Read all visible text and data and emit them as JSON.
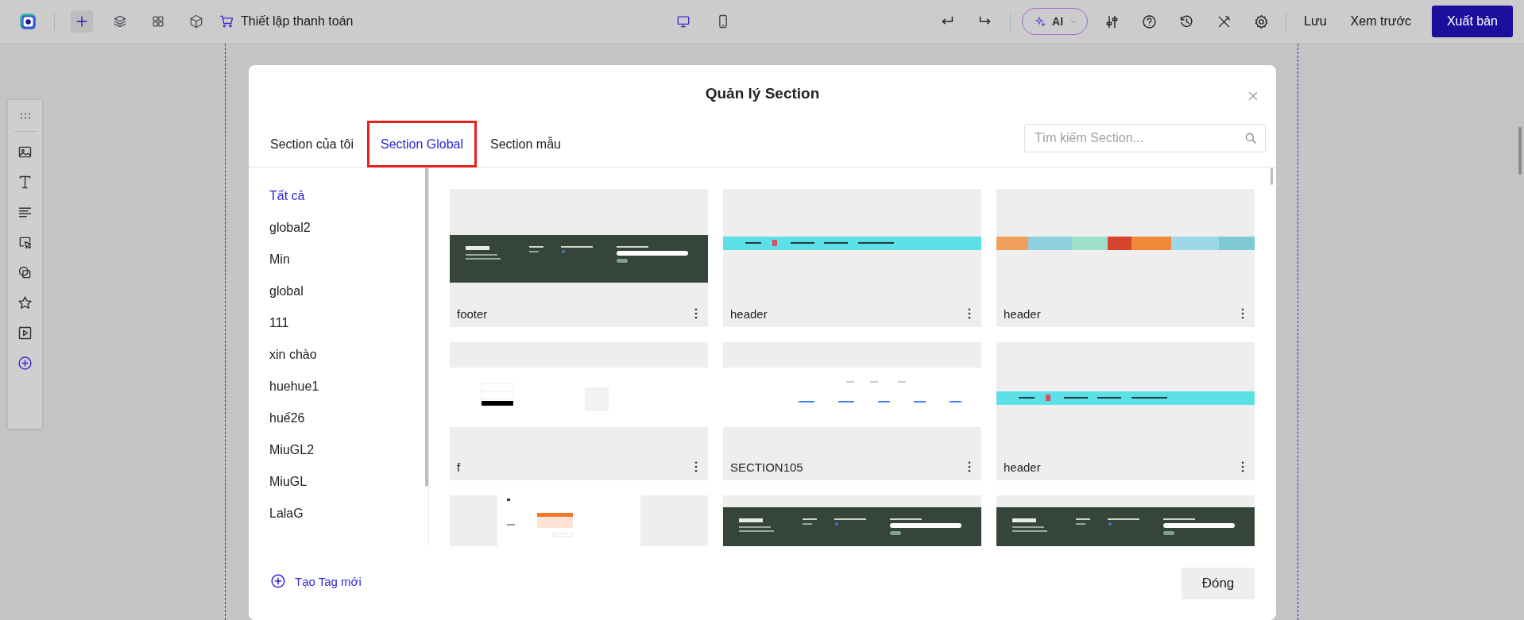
{
  "topbar": {
    "tools": [
      {
        "kind": "add",
        "selected": true
      },
      {
        "kind": "layers",
        "selected": false
      },
      {
        "kind": "grid",
        "selected": false
      },
      {
        "kind": "box",
        "selected": false
      }
    ],
    "checkout": "Thiết lập thanh toán",
    "devices": [
      {
        "kind": "desktop",
        "selected": true
      },
      {
        "kind": "mobile",
        "selected": false
      }
    ],
    "ai": "AI",
    "save": "Lưu",
    "preview": "Xem trước",
    "publish": "Xuất bản"
  },
  "left_toolbar": [
    {
      "kind": "image"
    },
    {
      "kind": "text"
    },
    {
      "kind": "paragraph"
    },
    {
      "kind": "pointer"
    },
    {
      "kind": "shapes"
    },
    {
      "kind": "star"
    },
    {
      "kind": "video"
    },
    {
      "kind": "add"
    }
  ],
  "modal": {
    "title": "Quản lý Section",
    "tabs": [
      {
        "label": "Section của tôi",
        "selected": false,
        "highlighted": false
      },
      {
        "label": "Section Global",
        "selected": true,
        "highlighted": true
      },
      {
        "label": "Section mẫu",
        "selected": false,
        "highlighted": false
      }
    ],
    "search": {
      "placeholder": "Tìm kiếm Section..."
    },
    "tags": [
      {
        "label": "Tất cả",
        "selected": true
      },
      {
        "label": "global2",
        "selected": false
      },
      {
        "label": "Min",
        "selected": false
      },
      {
        "label": "global",
        "selected": false
      },
      {
        "label": "111",
        "selected": false
      },
      {
        "label": "xin chào",
        "selected": false
      },
      {
        "label": "huehue1",
        "selected": false
      },
      {
        "label": "huế26",
        "selected": false
      },
      {
        "label": "MiuGL2",
        "selected": false
      },
      {
        "label": "MiuGL",
        "selected": false
      },
      {
        "label": "LalaG",
        "selected": false
      }
    ],
    "cards": [
      {
        "name": "footer",
        "kind": "dark-footer"
      },
      {
        "name": "header",
        "kind": "cyan-nav"
      },
      {
        "name": "header",
        "kind": "photo-strip"
      },
      {
        "name": "f",
        "kind": "form"
      },
      {
        "name": "SECTION105",
        "kind": "link-row"
      },
      {
        "name": "header",
        "kind": "cyan-nav-low"
      },
      {
        "kind": "orange-card"
      },
      {
        "kind": "dark-footer-top"
      },
      {
        "kind": "dark-footer-top"
      }
    ],
    "add_tag": "Tạo Tag mới",
    "close": "Đóng"
  }
}
